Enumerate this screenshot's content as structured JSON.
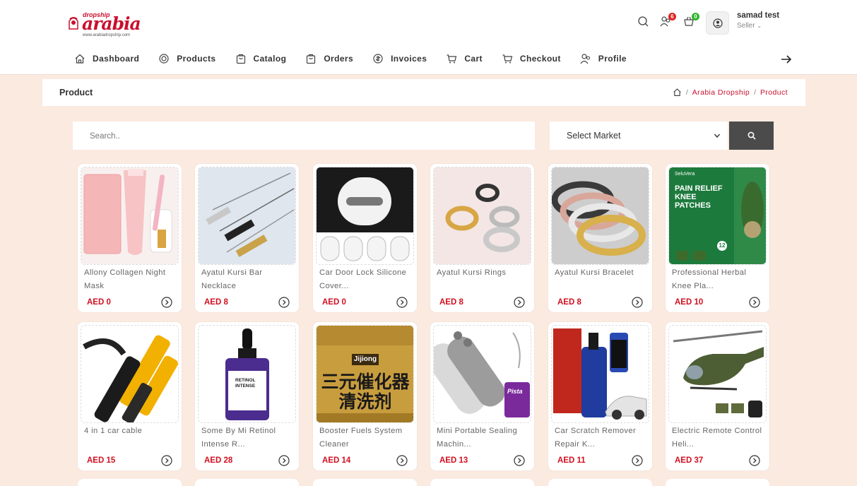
{
  "brand": {
    "logo_top": "dropship",
    "logo_main": "arabia",
    "logo_url": "www.arabiadropship.com",
    "accent": "#c8102e"
  },
  "header": {
    "notifications_count": "6",
    "cart_count": "0",
    "user_name": "samad test",
    "user_role": "Seller"
  },
  "nav": [
    {
      "label": "Dashboard",
      "icon": "home-icon"
    },
    {
      "label": "Products",
      "icon": "target-icon"
    },
    {
      "label": "Catalog",
      "icon": "bag-icon"
    },
    {
      "label": "Orders",
      "icon": "bag-icon"
    },
    {
      "label": "Invoices",
      "icon": "invoice-icon"
    },
    {
      "label": "Cart",
      "icon": "cart-icon"
    },
    {
      "label": "Checkout",
      "icon": "cart-icon"
    },
    {
      "label": "Profile",
      "icon": "users-icon"
    }
  ],
  "page": {
    "title": "Product",
    "breadcrumb": [
      "Arabia Dropship",
      "Product"
    ]
  },
  "search": {
    "placeholder": "Search..",
    "market_label": "Select Market"
  },
  "products": [
    {
      "name": "Allony Collagen Night Mask",
      "price": "AED 0"
    },
    {
      "name": "Ayatul Kursi Bar Necklace",
      "price": "AED 8"
    },
    {
      "name": "Car Door Lock Silicone Cover...",
      "price": "AED 0"
    },
    {
      "name": "Ayatul Kursi Rings",
      "price": "AED 8"
    },
    {
      "name": "Ayatul Kursi Bracelet",
      "price": "AED 8"
    },
    {
      "name": "Professional Herbal Knee Pla...",
      "price": "AED 10"
    },
    {
      "name": "4 in 1 car cable",
      "price": "AED 15"
    },
    {
      "name": "Some By Mi Retinol Intense R...",
      "price": "AED 28"
    },
    {
      "name": "Booster Fuels System Cleaner",
      "price": "AED 14"
    },
    {
      "name": "Mini Portable Sealing Machin...",
      "price": "AED 13"
    },
    {
      "name": "Car Scratch Remover Repair K...",
      "price": "AED 11"
    },
    {
      "name": "Electric Remote Control Heli...",
      "price": "AED 37"
    }
  ],
  "image_text": {
    "knee_brand": "SeluVera",
    "knee_title": "PAIN RELIEF KNEE PATCHES",
    "knee_count": "12",
    "retinol_title": "RETINOL INTENSE",
    "cleaner_brand": "Jijiong",
    "cleaner_cn": "三元催化器清洗剂",
    "sealer_brand": "Pista"
  }
}
